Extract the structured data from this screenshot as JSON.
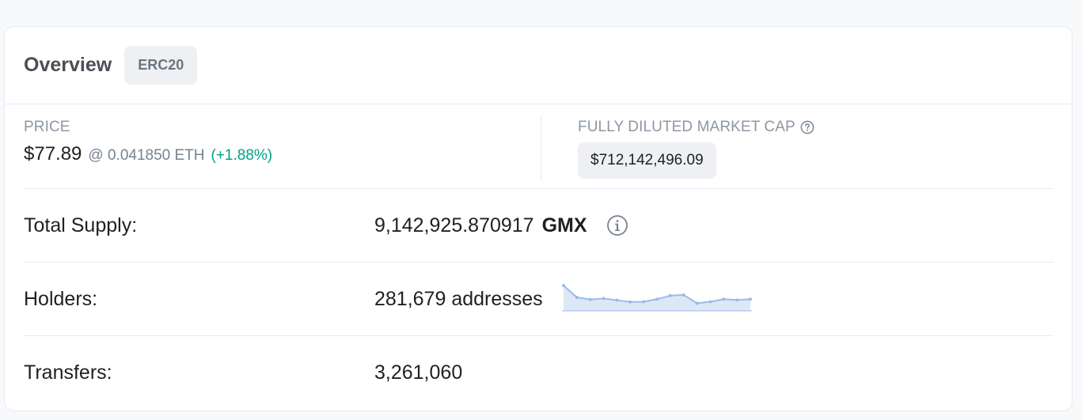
{
  "header": {
    "title": "Overview",
    "badge": "ERC20"
  },
  "price": {
    "label": "PRICE",
    "usd": "$77.89",
    "eth": "@ 0.041850 ETH",
    "change": "(+1.88%)"
  },
  "market_cap": {
    "label": "FULLY DILUTED MARKET CAP",
    "value": "$712,142,496.09"
  },
  "rows": {
    "total_supply": {
      "label": "Total Supply:",
      "value": "9,142,925.870917",
      "symbol": "GMX"
    },
    "holders": {
      "label": "Holders:",
      "value": "281,679 addresses"
    },
    "transfers": {
      "label": "Transfers:",
      "value": "3,261,060"
    }
  },
  "holders_trend": [
    10.0,
    5.3,
    4.5,
    4.9,
    4.2,
    3.5,
    3.6,
    4.6,
    6.0,
    6.3,
    3.0,
    3.6,
    4.6,
    4.3,
    4.6
  ],
  "colors": {
    "positive": "#00a186",
    "sparkline": "#9bbbe6",
    "sparkline_fill": "#dce8f8"
  },
  "icons": {
    "help": "question-circle-icon",
    "info": "info-circle-icon"
  }
}
